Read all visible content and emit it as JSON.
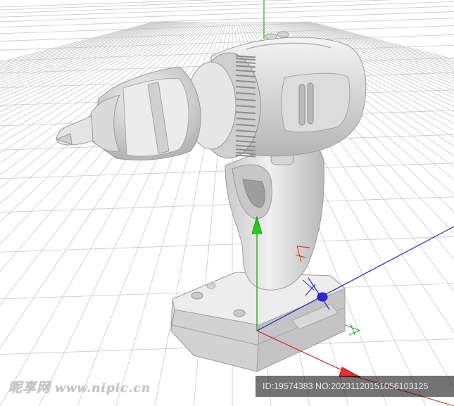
{
  "scene": {
    "subject": "cordless-drill-3d-model",
    "background_color": "#ffffff",
    "grid_color": "#c8c8c8",
    "axis_colors": {
      "x": "#e02020",
      "y": "#20b020",
      "z": "#2020d0"
    }
  },
  "watermark": {
    "brand": "昵享网",
    "site": "www.nipic.cn"
  },
  "image_info": {
    "id_text": "ID:19574383 NO:20231120151056103125"
  }
}
